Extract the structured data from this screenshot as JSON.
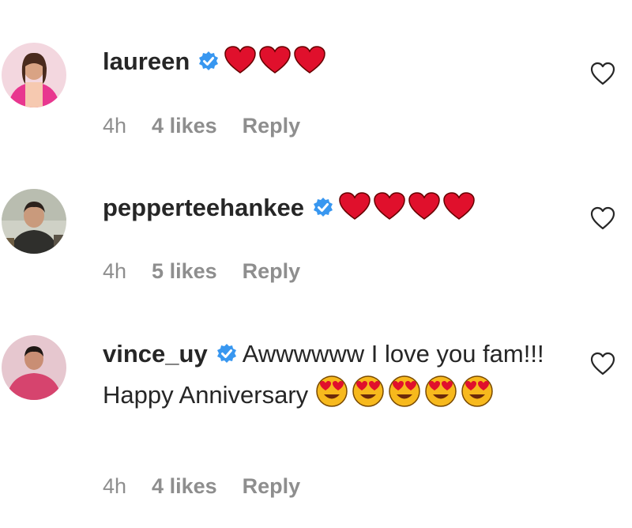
{
  "comments": [
    {
      "username": "laureen",
      "verified": true,
      "text": "",
      "emojis": [
        "red-heart",
        "red-heart",
        "red-heart"
      ],
      "time": "4h",
      "likes": "4 likes",
      "reply": "Reply"
    },
    {
      "username": "pepperteehankee",
      "verified": true,
      "text": "",
      "emojis": [
        "red-heart",
        "red-heart",
        "red-heart",
        "red-heart"
      ],
      "time": "4h",
      "likes": "5 likes",
      "reply": "Reply"
    },
    {
      "username": "vince_uy",
      "verified": true,
      "text": "Awwwwww I love you fam!!! Happy Anniversary",
      "emojis": [
        "heart-eyes",
        "heart-eyes",
        "heart-eyes",
        "heart-eyes",
        "heart-eyes"
      ],
      "time": "4h",
      "likes": "4 likes",
      "reply": "Reply"
    }
  ],
  "colors": {
    "verified": "#3897f0",
    "heart": "#e0102c",
    "emoji_face": "#f7b91d",
    "meta_text": "#8e8e8e",
    "text": "#262626"
  },
  "icons": {
    "like": "heart-outline-icon",
    "verified": "verified-badge-icon"
  }
}
